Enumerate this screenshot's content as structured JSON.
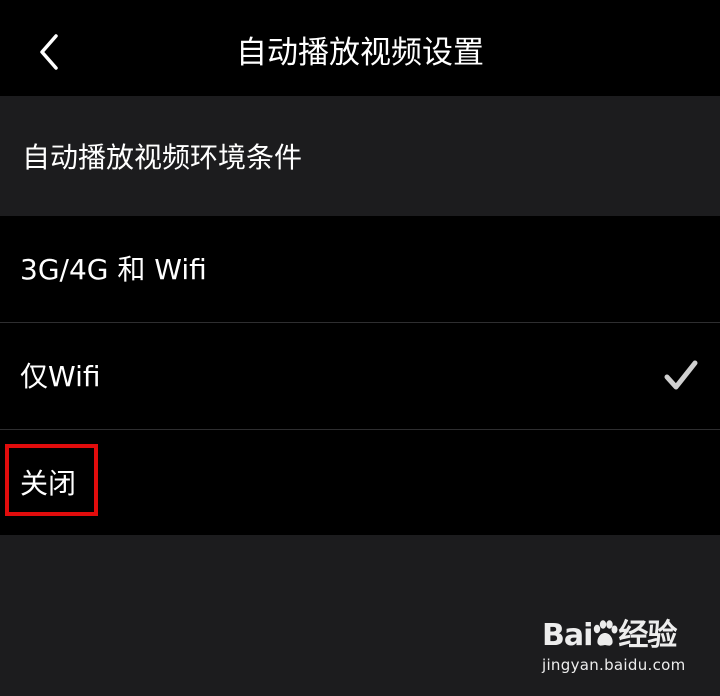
{
  "navbar": {
    "title": "自动播放视频设置",
    "back_icon": "chevron-left-icon"
  },
  "section": {
    "header": "自动播放视频环境条件"
  },
  "options": [
    {
      "label": "3G/4G 和 Wifi",
      "selected": false
    },
    {
      "label": "仅Wifi",
      "selected": true
    },
    {
      "label": "关闭",
      "selected": false
    }
  ],
  "annotation": {
    "highlight_color": "#e10c0c",
    "highlighted_option": "关闭"
  },
  "watermark": {
    "brand_prefix": "Bai",
    "brand_suffix": "经验",
    "url": "jingyan.baidu.com"
  },
  "colors": {
    "navbar_bg": "#000000",
    "section_bg": "#1c1c1e",
    "row_bg": "#000000",
    "divider": "#2e2e30",
    "check": "#d0d0d0"
  }
}
